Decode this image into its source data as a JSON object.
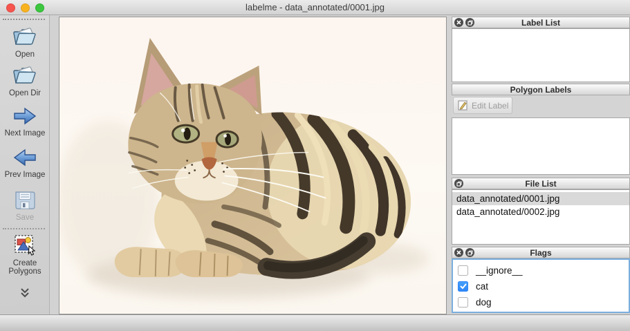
{
  "window": {
    "title": "labelme - data_annotated/0001.jpg"
  },
  "toolbar": {
    "items": [
      {
        "label": "Open",
        "icon": "folder-open-icon"
      },
      {
        "label": "Open Dir",
        "icon": "folder-open-dir-icon"
      },
      {
        "label": "Next Image",
        "icon": "arrow-right-icon"
      },
      {
        "label": "Prev Image",
        "icon": "arrow-left-icon"
      },
      {
        "label": "Save",
        "icon": "floppy-save-icon",
        "disabled": true
      },
      {
        "label": "Create Polygons",
        "icon": "create-polygons-icon"
      }
    ]
  },
  "panels": {
    "label_list": {
      "title": "Label List"
    },
    "polygon_labels": {
      "title": "Polygon Labels",
      "edit_button": "Edit Label"
    },
    "file_list": {
      "title": "File List",
      "items": [
        {
          "name": "data_annotated/0001.jpg",
          "selected": true
        },
        {
          "name": "data_annotated/0002.jpg",
          "selected": false
        }
      ]
    },
    "flags": {
      "title": "Flags",
      "items": [
        {
          "label": "__ignore__",
          "checked": false
        },
        {
          "label": "cat",
          "checked": true
        },
        {
          "label": "dog",
          "checked": false
        }
      ]
    }
  },
  "colors": {
    "accent": "#46a0fb",
    "focus_ring": "#7aaede",
    "selection": "#d9d9d9"
  }
}
